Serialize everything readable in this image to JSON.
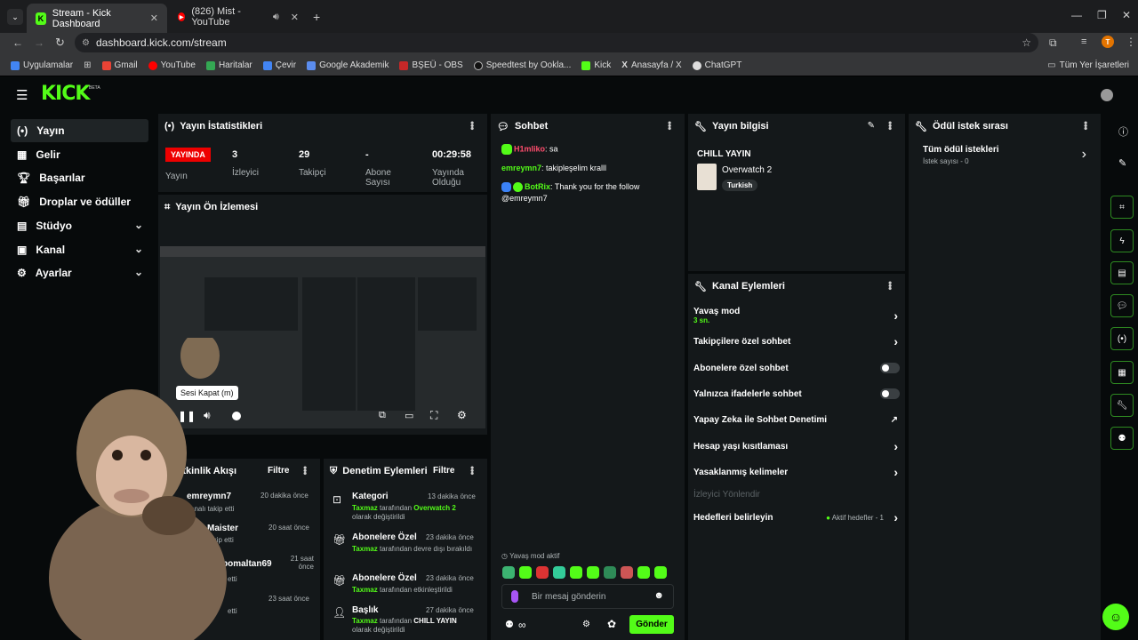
{
  "browser": {
    "tabs": [
      {
        "label": "Stream - Kick Dashboard",
        "active": true
      },
      {
        "label": "(826) Mist - YouTube",
        "active": false
      }
    ],
    "url": "dashboard.kick.com/stream",
    "bookmarks": [
      "Uygulamalar",
      "Gmail",
      "YouTube",
      "Haritalar",
      "Çevir",
      "Google Akademik",
      "BŞEÜ - OBS",
      "Speedtest by Ookla...",
      "Kick",
      "Anasayfa / X",
      "ChatGPT"
    ],
    "all_bookmarks": "Tüm Yer İşaretleri",
    "profile_initial": "T"
  },
  "app": {
    "logo": "KICK",
    "logo_badge": "BETA",
    "accent": "#53fc18"
  },
  "sidebar": {
    "items": [
      {
        "label": "Yayın",
        "icon": "broadcast-icon"
      },
      {
        "label": "Gelir",
        "icon": "revenue-icon"
      },
      {
        "label": "Başarılar",
        "icon": "trophy-icon"
      },
      {
        "label": "Droplar ve ödüller",
        "icon": "gift-icon"
      },
      {
        "label": "Stüdyo",
        "icon": "studio-icon"
      },
      {
        "label": "Kanal",
        "icon": "channel-icon"
      },
      {
        "label": "Ayarlar",
        "icon": "gear-icon"
      }
    ]
  },
  "stats": {
    "title": "Yayın İstatistikleri",
    "live_badge": "YAYINDA",
    "live_label": "Yayın",
    "viewers_value": "3",
    "viewers_label": "İzleyici",
    "followers_value": "29",
    "followers_label": "Takipçi",
    "subs_value": "-",
    "subs_label": "Abone Sayısı",
    "uptime_value": "00:29:58",
    "uptime_label": "Yayında Olduğu"
  },
  "preview": {
    "title": "Yayın Ön İzlemesi",
    "tooltip": "Sesi Kapat (m)"
  },
  "activity": {
    "title": "Etkinlik Akışı",
    "filter": "Filtre",
    "items": [
      {
        "name": "emreymn7",
        "time": "20 dakika önce",
        "desc": "kanalı takip etti"
      },
      {
        "name": "Maister",
        "time": "20 saat önce",
        "desc": "takip etti"
      },
      {
        "name": "bomaltan69",
        "time": "21 saat önce",
        "desc": "etti"
      },
      {
        "name": "",
        "time": "23 saat önce",
        "desc": "etti"
      }
    ]
  },
  "moderation": {
    "title": "Denetim Eylemleri",
    "filter": "Filtre",
    "items": [
      {
        "title": "Kategori",
        "time": "13 dakika önce",
        "actor": "Taxmaz",
        "mid": "tarafından",
        "value": "Overwatch 2",
        "end": "olarak değiştirildi"
      },
      {
        "title": "Abonelere Özel",
        "time": "23 dakika önce",
        "actor": "Taxmaz",
        "mid": "tarafından devre dışı",
        "value": "",
        "end": "bırakıldı"
      },
      {
        "title": "Abonelere Özel",
        "time": "23 dakika önce",
        "actor": "Taxmaz",
        "mid": "tarafından etkinleştirildi",
        "value": "",
        "end": ""
      },
      {
        "title": "Başlık",
        "time": "27 dakika önce",
        "actor": "Taxmaz",
        "mid": "tarafından",
        "value": "CHILL YAYIN",
        "end": "olarak değiştirildi"
      }
    ]
  },
  "chat": {
    "title": "Sohbet",
    "messages": [
      {
        "user": "H1mliko",
        "text": ": sa",
        "color": "#ff4d6d"
      },
      {
        "user": "emreymn7",
        "text": ": takipleşelim kralll",
        "color": "#53fc18"
      },
      {
        "user": "BotRix",
        "text": ": Thank you for the follow @emreymn7",
        "color": "#53fc18"
      }
    ],
    "slow_mode": "Yavaş mod aktif",
    "placeholder": "Bir mesaj gönderin",
    "send": "Gönder",
    "infinity": "∞"
  },
  "stream_info": {
    "title": "Yayın bilgisi",
    "stream_title": "CHILL YAYIN",
    "category": "Overwatch 2",
    "tag": "Turkish"
  },
  "channel_actions": {
    "title": "Kanal Eylemleri",
    "slow_mode": "Yavaş mod",
    "slow_value": "3 sn.",
    "followers_only": "Takipçilere özel sohbet",
    "subs_only": "Abonelere özel sohbet",
    "emotes_only": "Yalnızca ifadelerle sohbet",
    "ai_moderation": "Yapay Zeka ile Sohbet Denetimi",
    "account_age": "Hesap yaşı kısıtlaması",
    "banned_words": "Yasaklanmış kelimeler",
    "raid": "İzleyici Yönlendir",
    "goals": "Hedefleri belirleyin",
    "goals_status": "Aktif hedefler - 1"
  },
  "rewards": {
    "title": "Ödül istek sırası",
    "all": "Tüm ödül istekleri",
    "count": "İstek sayısı - 0"
  }
}
